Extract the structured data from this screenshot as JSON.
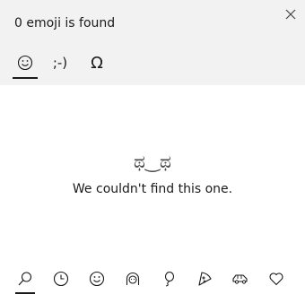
{
  "header": {
    "title": "0 emoji is found",
    "close_icon": "close-icon"
  },
  "mode_tabs": [
    {
      "label": "☺",
      "icon": "emoji-smiley-icon",
      "active": true
    },
    {
      "label": ";-)",
      "icon": "kaomoji-icon",
      "active": false
    },
    {
      "label": "Ω",
      "icon": "symbols-omega-icon",
      "active": false
    }
  ],
  "empty_state": {
    "face": "ಥ‿ಥ",
    "message": "We couldn't find this one."
  },
  "categories": [
    {
      "icon": "search-icon",
      "active": true
    },
    {
      "icon": "recent-clock-icon",
      "active": false
    },
    {
      "icon": "smiley-face-icon",
      "active": false
    },
    {
      "icon": "people-icon",
      "active": false
    },
    {
      "icon": "celebration-balloon-icon",
      "active": false
    },
    {
      "icon": "food-pizza-icon",
      "active": false
    },
    {
      "icon": "travel-car-icon",
      "active": false
    },
    {
      "icon": "heart-icon",
      "active": false
    }
  ],
  "colors": {
    "header_bg": "#f2f2f2",
    "text": "#1a1a1a",
    "accent_underline": "#1a1a1a"
  }
}
